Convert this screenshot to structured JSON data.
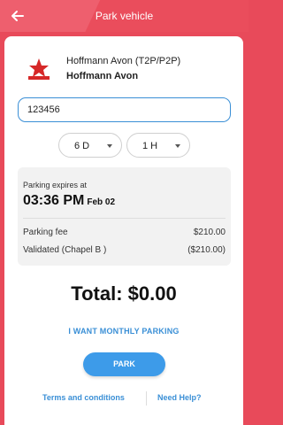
{
  "header": {
    "title": "Park vehicle",
    "back_icon": "arrow-left-icon"
  },
  "lot": {
    "subtitle": "Hoffmann Avon (T2P/P2P)",
    "name": "Hoffmann Avon",
    "logo_icon": "star-logo-icon"
  },
  "plate": {
    "value": "123456"
  },
  "duration": {
    "days": "6 D",
    "hours": "1 H"
  },
  "expiry": {
    "label": "Parking expires at",
    "time": "03:36 PM",
    "date": "Feb 02"
  },
  "fees": [
    {
      "label": "Parking fee",
      "amount": "$210.00"
    },
    {
      "label": "Validated (Chapel B )",
      "amount": "($210.00)"
    }
  ],
  "total": "Total: $0.00",
  "monthly_link": "I WANT MONTHLY PARKING",
  "park_button": "PARK",
  "footer": {
    "terms": "Terms and conditions",
    "help": "Need Help?"
  },
  "colors": {
    "header": "#ea4d5c",
    "accent": "#3a8fd6",
    "button": "#3d9be9"
  }
}
